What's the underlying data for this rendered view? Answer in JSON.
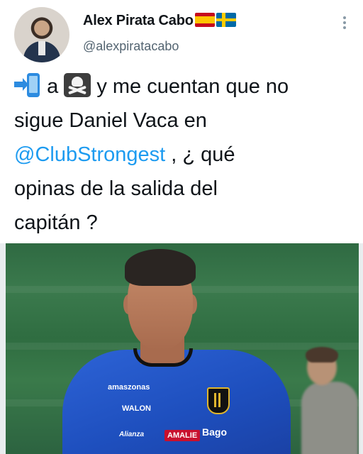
{
  "author": {
    "display_name": "Alex Pirata Cabo",
    "handle": "@alexpiratacabo",
    "flags": [
      "spain-flag",
      "sweden-flag"
    ]
  },
  "tweet": {
    "line1_mid": "a",
    "line1_end": "y me cuentan que no",
    "line2": "sigue Daniel Vaca en",
    "mention": "@ClubStrongest",
    "line3_after_mention": ", ¿ qué",
    "line4": "opinas de la salida del",
    "line5": "capitán ?",
    "emojis": [
      "incoming-phone-emoji",
      "pirate-flag-emoji"
    ]
  },
  "photo": {
    "sponsors": {
      "amazonas": "amaszonas",
      "walon": "WALON",
      "alianza": "Alianza",
      "amalie": "AMALIE",
      "bago": "Bago"
    }
  },
  "colors": {
    "mention": "#1d9bf0",
    "handle": "#536471",
    "jersey": "#2d63d6"
  }
}
